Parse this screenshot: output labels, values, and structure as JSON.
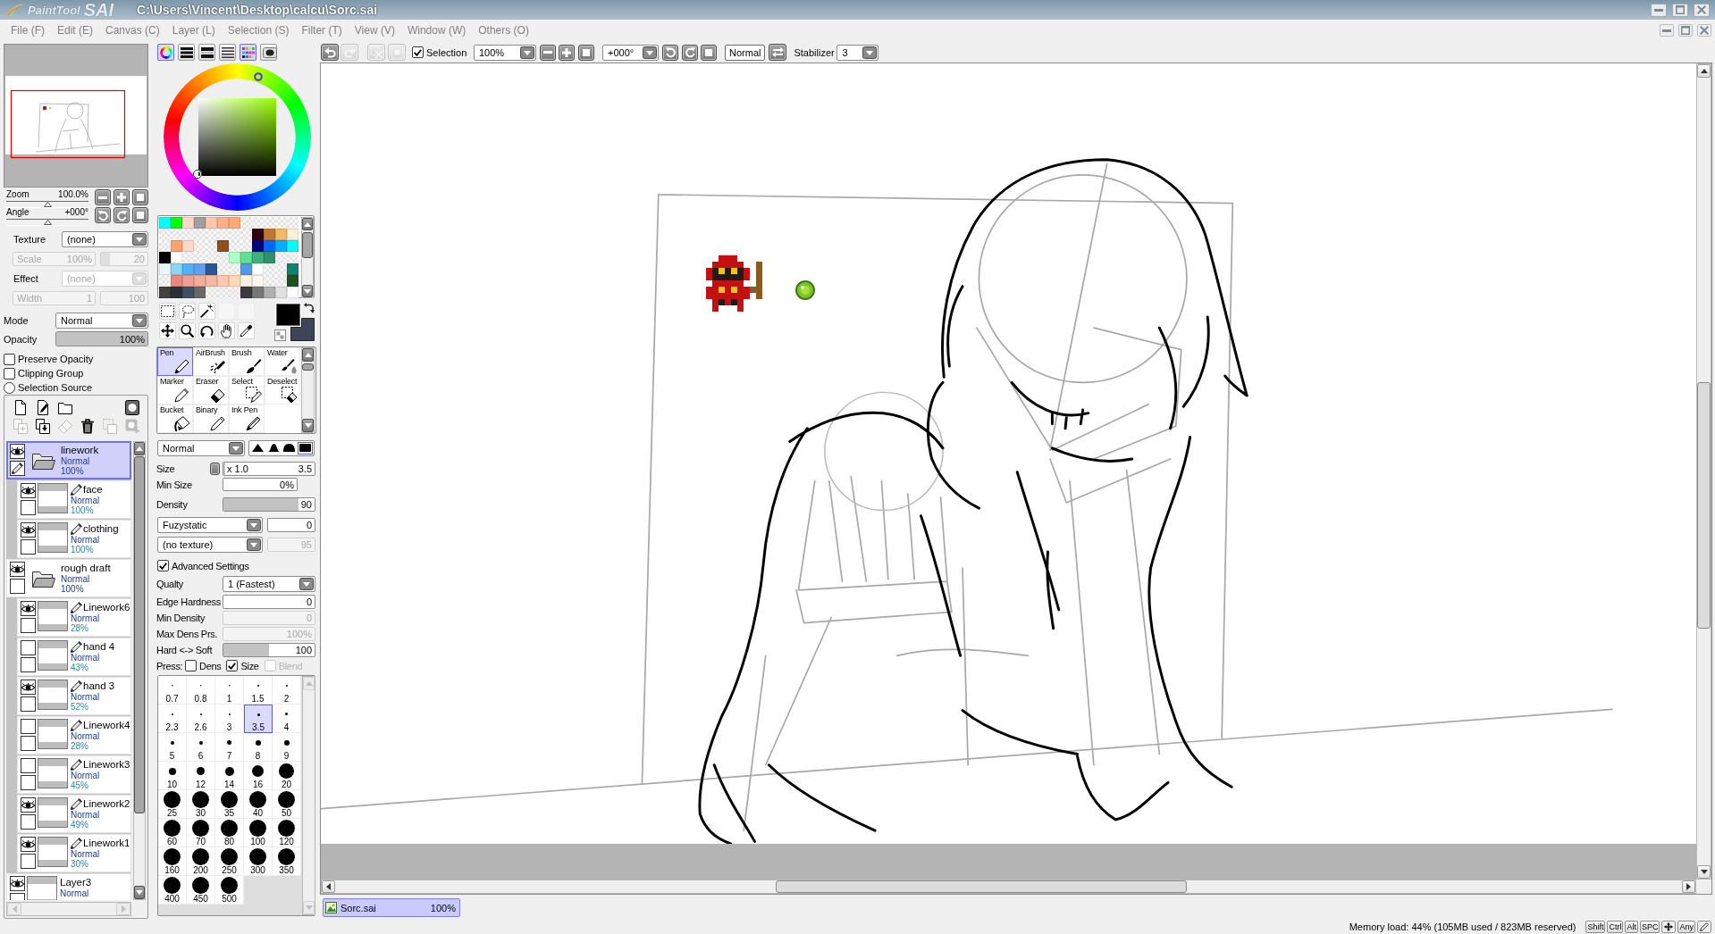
{
  "window": {
    "logo_small": "PaintTool",
    "logo_large": "SAI",
    "title": "C:\\Users\\Vincent\\Desktop\\calcu\\Sorc.sai"
  },
  "menu": [
    "File (F)",
    "Edit (E)",
    "Canvas (C)",
    "Layer (L)",
    "Selection (S)",
    "Filter (T)",
    "View (V)",
    "Window (W)",
    "Others (O)"
  ],
  "navigator": {
    "zoom": {
      "label": "Zoom",
      "value": "100.0%",
      "level": 0.5
    },
    "angle": {
      "label": "Angle",
      "value": "+000°",
      "level": 0.5
    }
  },
  "layer_properties": {
    "texture": {
      "label": "Texture",
      "value": "(none)",
      "disabled": false
    },
    "scale": {
      "label": "Scale",
      "value": "100%",
      "disabled": true,
      "amount": {
        "value": "20",
        "level": 0.2
      }
    },
    "effect": {
      "label": "Effect",
      "value": "(none)",
      "disabled": true
    },
    "width": {
      "label": "Width",
      "value": "1",
      "disabled": true,
      "amount": {
        "value": "100"
      }
    },
    "mode": {
      "label": "Mode",
      "value": "Normal"
    },
    "opacity": {
      "label": "Opacity",
      "value": "100%",
      "level": 1
    },
    "options": [
      {
        "kind": "checkbox",
        "label": "Preserve Opacity",
        "checked": false
      },
      {
        "kind": "checkbox",
        "label": "Clipping Group",
        "checked": false
      },
      {
        "kind": "radio",
        "label": "Selection Source",
        "checked": false
      }
    ]
  },
  "layer_toolbar": [
    {
      "disabled": false
    },
    {
      "disabled": false
    },
    {
      "disabled": false
    },
    {
      "disabled": false
    },
    {
      "disabled": true
    },
    {
      "disabled": false
    },
    {
      "disabled": true
    },
    {
      "disabled": false
    },
    {
      "disabled": true
    },
    {
      "disabled": true
    }
  ],
  "layers": [
    {
      "kind": "folder",
      "name": "linework",
      "mode": "Normal",
      "opacity": "100%",
      "visible": true,
      "selected": true,
      "children": [
        {
          "kind": "linework",
          "name": "face",
          "mode": "Normal",
          "opacity": "100%",
          "visible": true,
          "selected": false
        },
        {
          "kind": "linework",
          "name": "clothing",
          "mode": "Normal",
          "opacity": "100%",
          "visible": true,
          "selected": false
        }
      ]
    },
    {
      "kind": "folder",
      "name": "rough draft",
      "mode": "Normal",
      "opacity": "100%",
      "visible": true,
      "selected": false,
      "children": [
        {
          "kind": "linework",
          "name": "Linework6",
          "mode": "Normal",
          "opacity": "28%",
          "visible": true,
          "selected": false
        },
        {
          "kind": "linework",
          "name": "hand 4",
          "mode": "Normal",
          "opacity": "43%",
          "visible": false,
          "selected": false
        },
        {
          "kind": "linework",
          "name": "hand 3",
          "mode": "Normal",
          "opacity": "52%",
          "visible": true,
          "selected": false
        },
        {
          "kind": "linework",
          "name": "Linework4",
          "mode": "Normal",
          "opacity": "28%",
          "visible": false,
          "selected": false
        },
        {
          "kind": "linework",
          "name": "Linework3",
          "mode": "Normal",
          "opacity": "45%",
          "visible": false,
          "selected": false
        },
        {
          "kind": "linework",
          "name": "Linework2",
          "mode": "Normal",
          "opacity": "49%",
          "visible": true,
          "selected": false
        },
        {
          "kind": "linework",
          "name": "Linework1",
          "mode": "Normal",
          "opacity": "30%",
          "visible": true,
          "selected": false
        }
      ]
    },
    {
      "kind": "layer",
      "name": "Layer3",
      "mode": "Normal",
      "visible": true,
      "selected": false
    }
  ],
  "color_tabs": [
    {
      "selected": true
    },
    {
      "selected": false
    },
    {
      "selected": false
    },
    {
      "selected": false
    },
    {
      "selected": true
    },
    {
      "selected": false
    }
  ],
  "palette": [
    {
      "kind": "color",
      "color": "#00ffff"
    },
    {
      "kind": "color",
      "color": "#00ff00"
    },
    {
      "kind": "color",
      "color": "#ffd8c8"
    },
    {
      "kind": "color",
      "color": "#a0a0a0"
    },
    {
      "kind": "color",
      "color": "#ffc8a8"
    },
    {
      "kind": "color",
      "color": "#ffb088"
    },
    {
      "kind": "color",
      "color": "#ffa878"
    },
    {
      "kind": "empty"
    },
    {
      "kind": "empty"
    },
    {
      "kind": "empty"
    },
    {
      "kind": "empty"
    },
    {
      "kind": "empty"
    },
    {
      "kind": "empty"
    },
    {
      "kind": "empty"
    },
    {
      "kind": "empty"
    },
    {
      "kind": "empty"
    },
    {
      "kind": "empty"
    },
    {
      "kind": "empty"
    },
    {
      "kind": "empty"
    },
    {
      "kind": "empty"
    },
    {
      "kind": "color",
      "color": "#300010"
    },
    {
      "kind": "color",
      "color": "#c07830"
    },
    {
      "kind": "color",
      "color": "#f0b868"
    },
    {
      "kind": "color",
      "color": "#fff0d8"
    },
    {
      "kind": "empty"
    },
    {
      "kind": "color",
      "color": "#ffa070"
    },
    {
      "kind": "color",
      "color": "#ffd8c8"
    },
    {
      "kind": "empty"
    },
    {
      "kind": "empty"
    },
    {
      "kind": "color",
      "color": "#905018"
    },
    {
      "kind": "empty"
    },
    {
      "kind": "empty"
    },
    {
      "kind": "color",
      "color": "#000080"
    },
    {
      "kind": "color",
      "color": "#0068ff"
    },
    {
      "kind": "color",
      "color": "#00b0ff"
    },
    {
      "kind": "color",
      "color": "#00ffff"
    },
    {
      "kind": "color",
      "color": "#000000"
    },
    {
      "kind": "color",
      "color": "#ffffff"
    },
    {
      "kind": "empty"
    },
    {
      "kind": "empty"
    },
    {
      "kind": "empty"
    },
    {
      "kind": "empty"
    },
    {
      "kind": "color",
      "color": "#b0ffc8"
    },
    {
      "kind": "color",
      "color": "#60e090"
    },
    {
      "kind": "color",
      "color": "#40b080"
    },
    {
      "kind": "color",
      "color": "#309068"
    },
    {
      "kind": "empty"
    },
    {
      "kind": "empty"
    },
    {
      "kind": "color",
      "color": "#e8f8ff"
    },
    {
      "kind": "color",
      "color": "#88d8f0"
    },
    {
      "kind": "color",
      "color": "#50b0f8"
    },
    {
      "kind": "color",
      "color": "#60a0f0"
    },
    {
      "kind": "color",
      "color": "#285890"
    },
    {
      "kind": "empty"
    },
    {
      "kind": "empty"
    },
    {
      "kind": "color",
      "color": "#5098e8"
    },
    {
      "kind": "color",
      "color": "#ffffff"
    },
    {
      "kind": "empty"
    },
    {
      "kind": "empty"
    },
    {
      "kind": "color",
      "color": "#108070"
    },
    {
      "kind": "empty"
    },
    {
      "kind": "color",
      "color": "#e88880"
    },
    {
      "kind": "color",
      "color": "#f0a090"
    },
    {
      "kind": "color",
      "color": "#f0b098"
    },
    {
      "kind": "color",
      "color": "#f5b8a0"
    },
    {
      "kind": "color",
      "color": "#ffc8b0"
    },
    {
      "kind": "color",
      "color": "#ffd8b8"
    },
    {
      "kind": "color",
      "color": "#fff0e0"
    },
    {
      "kind": "color",
      "color": "#fff8f0"
    },
    {
      "kind": "empty"
    },
    {
      "kind": "empty"
    },
    {
      "kind": "color",
      "color": "#205020"
    },
    {
      "kind": "color",
      "color": "#404040"
    },
    {
      "kind": "color",
      "color": "#283038"
    },
    {
      "kind": "color",
      "color": "#405060"
    },
    {
      "kind": "color",
      "color": "#686868"
    },
    {
      "kind": "empty"
    },
    {
      "kind": "empty"
    },
    {
      "kind": "empty"
    },
    {
      "kind": "color",
      "color": "#403840"
    },
    {
      "kind": "color",
      "color": "#787878"
    },
    {
      "kind": "color",
      "color": "#b0b0b0"
    },
    {
      "kind": "color",
      "color": "#e0e0e0"
    },
    {
      "kind": "color",
      "color": "#ffffff"
    }
  ],
  "current_colors": [
    {
      "color": "#000000"
    },
    {
      "color": "#3c4658"
    }
  ],
  "tools": [
    {
      "label": "Pen",
      "selected": true
    },
    {
      "label": "AirBrush",
      "selected": false
    },
    {
      "label": "Brush",
      "selected": false
    },
    {
      "label": "Water",
      "selected": false
    },
    {
      "label": "Marker",
      "selected": false
    },
    {
      "label": "Eraser",
      "selected": false
    },
    {
      "label": "Select",
      "selected": false
    },
    {
      "label": "Deselect",
      "selected": false
    },
    {
      "label": "Bucket",
      "selected": false
    },
    {
      "label": "Binary",
      "selected": false
    },
    {
      "label": "Ink Pen",
      "selected": false
    }
  ],
  "brush": {
    "blend": "Normal",
    "tips": [
      {
        "selected": false
      },
      {
        "selected": false
      },
      {
        "selected": false
      },
      {
        "selected": true
      }
    ],
    "size": {
      "label": "Size",
      "multiplier": "x 1.0",
      "value": "3.5",
      "level": 0.02
    },
    "min_size": {
      "label": "Min Size",
      "value": "0%"
    },
    "density": {
      "label": "Density",
      "value": "90",
      "level": 0.82
    },
    "shape": {
      "value": "Fuzystatic",
      "amount": {
        "value": "0",
        "disabled": false
      }
    },
    "texture": {
      "value": "(no texture)",
      "amount": {
        "value": "95",
        "disabled": true
      }
    },
    "advanced": {
      "label": "Advanced Settings",
      "checked": true
    },
    "settings": [
      {
        "kind": "dropdown",
        "label": "Qualty",
        "value": "1 (Fastest)",
        "disabled": false
      },
      {
        "kind": "field",
        "label": "Edge Hardness",
        "value": "0",
        "disabled": false
      },
      {
        "kind": "field",
        "label": "Min Density",
        "value": "0",
        "disabled": true
      },
      {
        "kind": "field",
        "label": "Max Dens Prs.",
        "value": "100%",
        "disabled": true
      },
      {
        "kind": "slider",
        "label": "Hard <-> Soft",
        "value": "100",
        "level": 0.5,
        "disabled": false
      }
    ],
    "pressure": {
      "label": "Press:",
      "options": [
        {
          "label": "Dens",
          "checked": false,
          "disabled": false
        },
        {
          "label": "Size",
          "checked": true,
          "disabled": false
        },
        {
          "label": "Blend",
          "checked": false,
          "disabled": true
        }
      ]
    }
  },
  "brush_sizes": [
    {
      "label": "0.7",
      "selected": false
    },
    {
      "label": "0.8",
      "selected": false
    },
    {
      "label": "1",
      "selected": false
    },
    {
      "label": "1.5",
      "selected": false
    },
    {
      "label": "2",
      "selected": false
    },
    {
      "label": "2.3",
      "selected": false
    },
    {
      "label": "2.6",
      "selected": false
    },
    {
      "label": "3",
      "selected": false
    },
    {
      "label": "3.5",
      "selected": true
    },
    {
      "label": "4",
      "selected": false
    },
    {
      "label": "5",
      "selected": false
    },
    {
      "label": "6",
      "selected": false
    },
    {
      "label": "7",
      "selected": false
    },
    {
      "label": "8",
      "selected": false
    },
    {
      "label": "9",
      "selected": false
    },
    {
      "label": "10",
      "selected": false
    },
    {
      "label": "12",
      "selected": false
    },
    {
      "label": "14",
      "selected": false
    },
    {
      "label": "16",
      "selected": false
    },
    {
      "label": "20",
      "selected": false
    },
    {
      "label": "25",
      "selected": false
    },
    {
      "label": "30",
      "selected": false
    },
    {
      "label": "35",
      "selected": false
    },
    {
      "label": "40",
      "selected": false
    },
    {
      "label": "50",
      "selected": false
    },
    {
      "label": "60",
      "selected": false
    },
    {
      "label": "70",
      "selected": false
    },
    {
      "label": "80",
      "selected": false
    },
    {
      "label": "100",
      "selected": false
    },
    {
      "label": "120",
      "selected": false
    },
    {
      "label": "160",
      "selected": false
    },
    {
      "label": "200",
      "selected": false
    },
    {
      "label": "250",
      "selected": false
    },
    {
      "label": "300",
      "selected": false
    },
    {
      "label": "350",
      "selected": false
    },
    {
      "label": "400",
      "selected": false
    },
    {
      "label": "450",
      "selected": false
    },
    {
      "label": "500",
      "selected": false
    }
  ],
  "canvas_toolbar": {
    "history": [
      {
        "disabled": false
      },
      {
        "disabled": true
      },
      {
        "disabled": true
      },
      {
        "disabled": true
      }
    ],
    "selection": {
      "label": "Selection",
      "checked": true
    },
    "zoom": "100%",
    "angle": "+000°",
    "blend": "Normal",
    "stabilizer": {
      "label": "Stabilizer",
      "value": "3"
    }
  },
  "documents": [
    {
      "name": "Sorc.sai",
      "zoom": "100%",
      "selected": true
    }
  ],
  "status_bar": {
    "memory": "Memory load: 44% (105MB used / 823MB reserved)",
    "keys": [
      "Shift",
      "Ctrl",
      "Alt",
      "SPC"
    ],
    "any_key": "Any"
  }
}
